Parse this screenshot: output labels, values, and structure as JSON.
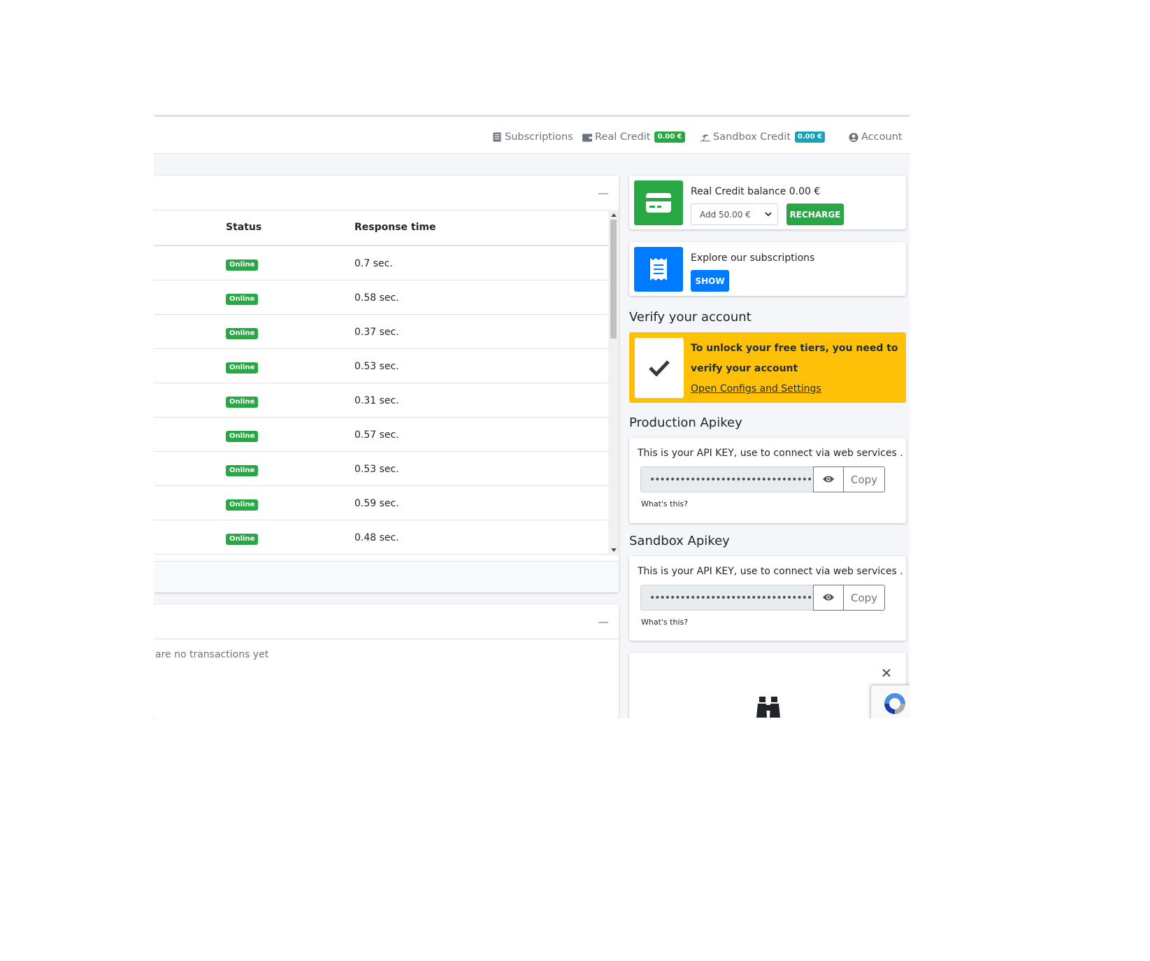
{
  "nav": {
    "subscriptions": "Subscriptions",
    "real_credit": "Real Credit",
    "real_credit_badge": "0.00 €",
    "sandbox_credit": "Sandbox Credit",
    "sandbox_credit_badge": "0.00 €",
    "account": "Account"
  },
  "status_table": {
    "columns": [
      "Status",
      "Response time"
    ],
    "rows": [
      {
        "status": "Online",
        "response": "0.7 sec."
      },
      {
        "status": "Online",
        "response": "0.58 sec."
      },
      {
        "status": "Online",
        "response": "0.37 sec."
      },
      {
        "status": "Online",
        "response": "0.53 sec."
      },
      {
        "status": "Online",
        "response": "0.31 sec."
      },
      {
        "status": "Online",
        "response": "0.57 sec."
      },
      {
        "status": "Online",
        "response": "0.53 sec."
      },
      {
        "status": "Online",
        "response": "0.59 sec."
      },
      {
        "status": "Online",
        "response": "0.48 sec."
      }
    ]
  },
  "transactions": {
    "empty_text": "are no transactions yet"
  },
  "credit_box": {
    "text": "Real Credit balance 0.00 €",
    "select_value": "Add 50.00 €",
    "recharge_label": "RECHARGE"
  },
  "subs_box": {
    "text": "Explore our subscriptions",
    "show_label": "SHOW"
  },
  "verify": {
    "title": "Verify your account",
    "line1": "To unlock your free tiers, you need to",
    "line2": "verify your account",
    "link": "Open Configs and Settings"
  },
  "production_api": {
    "title": "Production Apikey",
    "desc": "This is your API KEY, use to connect via web services .",
    "masked": "••••••••••••••••••••••••••••••••",
    "copy_label": "Copy",
    "whats_this": "What's this?"
  },
  "sandbox_api": {
    "title": "Sandbox Apikey",
    "desc": "This is your API KEY, use to connect via web services .",
    "masked": "••••••••••••••••••••••••••••••••",
    "copy_label": "Copy",
    "whats_this": "What's this?"
  },
  "colors": {
    "green": "#28a745",
    "teal": "#17a2b8",
    "blue": "#007bff",
    "yellow": "#ffc107"
  },
  "icons": {
    "subscriptions": "receipt-icon",
    "real_credit": "wallet-icon",
    "sandbox_credit": "beach-umbrella-icon",
    "account": "user-circle-icon",
    "credit_box": "credit-card-icon",
    "subs_box": "receipt-icon",
    "verify": "check-icon",
    "eye": "eye-icon",
    "close": "close-icon",
    "binoculars": "binoculars-icon"
  }
}
